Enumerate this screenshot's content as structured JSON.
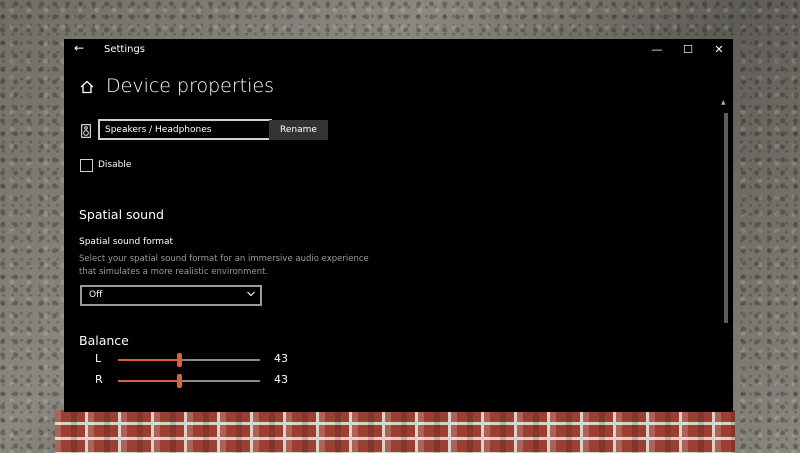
{
  "window": {
    "title": "Settings",
    "controls": {
      "minimize": "—",
      "maximize": "☐",
      "close": "✕"
    }
  },
  "page": {
    "title": "Device properties"
  },
  "device": {
    "name_value": "Speakers / Headphones",
    "rename_label": "Rename",
    "disable_label": "Disable",
    "disable_checked": false
  },
  "spatial": {
    "section_title": "Spatial sound",
    "format_label": "Spatial sound format",
    "description": "Select your spatial sound format for an immersive audio experience that simulates a more realistic environment.",
    "selected_value": "Off"
  },
  "balance": {
    "title": "Balance",
    "channels": [
      {
        "label": "L",
        "value": "43",
        "level": 0.43
      },
      {
        "label": "R",
        "value": "43",
        "level": 0.43
      }
    ]
  },
  "colors": {
    "accent": "#d9623b",
    "window_bg": "#000000"
  },
  "icons": [
    "back-arrow-icon",
    "home-icon",
    "speaker-icon",
    "chevron-down-icon"
  ]
}
